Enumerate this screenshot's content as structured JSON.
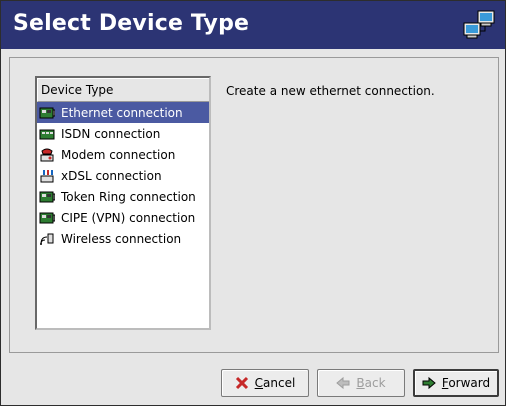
{
  "header": {
    "title": "Select Device Type",
    "icon": "network-computers-icon"
  },
  "list": {
    "column_header": "Device Type",
    "selected_index": 0,
    "items": [
      {
        "label": "Ethernet connection",
        "icon": "ethernet-card-icon"
      },
      {
        "label": "ISDN connection",
        "icon": "isdn-card-icon"
      },
      {
        "label": "Modem connection",
        "icon": "modem-icon"
      },
      {
        "label": "xDSL connection",
        "icon": "xdsl-icon"
      },
      {
        "label": "Token Ring connection",
        "icon": "token-ring-card-icon"
      },
      {
        "label": "CIPE (VPN) connection",
        "icon": "cipe-vpn-icon"
      },
      {
        "label": "Wireless connection",
        "icon": "wireless-icon"
      }
    ]
  },
  "description": "Create a new ethernet connection.",
  "buttons": {
    "cancel": {
      "accel": "C",
      "rest": "ancel"
    },
    "back": {
      "accel": "B",
      "rest": "ack"
    },
    "forward": {
      "accel": "F",
      "rest": "orward"
    }
  },
  "colors": {
    "header_bg": "#2c3474",
    "selection": "#4b5aa2",
    "window_bg": "#e6e6e6"
  }
}
